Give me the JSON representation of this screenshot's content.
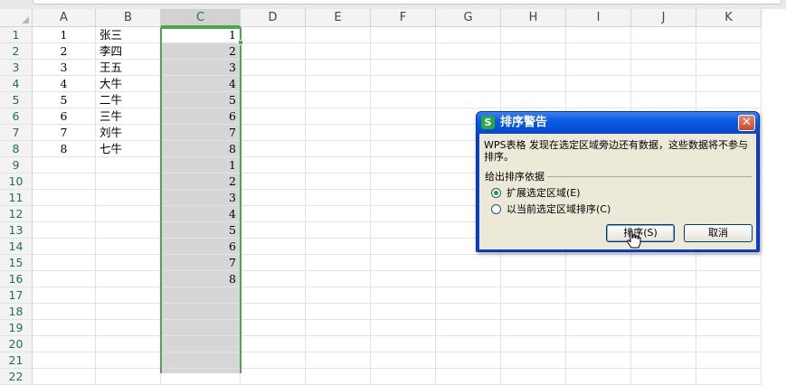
{
  "columns": [
    "A",
    "B",
    "C",
    "D",
    "E",
    "F",
    "G",
    "H",
    "I",
    "J",
    "K"
  ],
  "selected_column": "C",
  "rows": [
    "1",
    "2",
    "3",
    "4",
    "5",
    "6",
    "7",
    "8",
    "9",
    "10",
    "11",
    "12",
    "13",
    "14",
    "15",
    "16",
    "17",
    "18",
    "19",
    "20",
    "21",
    "22"
  ],
  "cells": {
    "A": [
      "1",
      "2",
      "3",
      "4",
      "5",
      "6",
      "7",
      "8"
    ],
    "B": [
      "张三",
      "李四",
      "王五",
      "大牛",
      "二牛",
      "三牛",
      "刘牛",
      "七牛"
    ],
    "C": [
      "1",
      "2",
      "3",
      "4",
      "5",
      "6",
      "7",
      "8",
      "1",
      "2",
      "3",
      "4",
      "5",
      "6",
      "7",
      "8"
    ]
  },
  "dialog": {
    "icon_letter": "S",
    "title": "排序警告",
    "close_glyph": "✕",
    "message": "WPS表格 发现在选定区域旁边还有数据，这些数据将不参与排序。",
    "group_label": "给出排序依据",
    "options": [
      {
        "label": "扩展选定区域(E)",
        "checked": true
      },
      {
        "label": "以当前选定区域排序(C)",
        "checked": false
      }
    ],
    "sort_button": "排序(S)",
    "cancel_button": "取消"
  },
  "colors": {
    "selection_green": "#4ca64c",
    "selection_fill": "#d6d6d6",
    "dialog_title_blue": "#0b5be3"
  }
}
